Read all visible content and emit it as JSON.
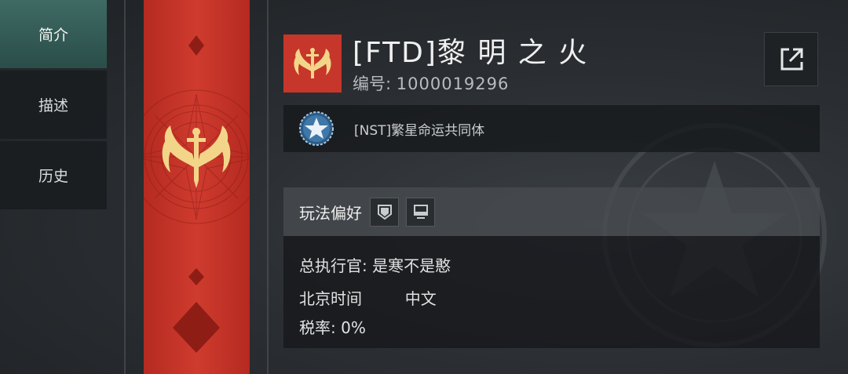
{
  "nav": {
    "items": [
      {
        "label": "简介",
        "active": true
      },
      {
        "label": "描述",
        "active": false
      },
      {
        "label": "历史",
        "active": false
      }
    ]
  },
  "banner": {
    "color": "#c7362a",
    "emblem_color": "#f3d58a",
    "emblem": "winged-sword-emblem"
  },
  "guild": {
    "name": "[FTD]黎 明 之 火",
    "id_label": "编号:",
    "id_value": "1000019296"
  },
  "share": {
    "icon": "external-link-icon"
  },
  "alliance": {
    "icon": "star-globe-icon",
    "name": "[NST]繁星命运共同体"
  },
  "preference": {
    "label": "玩法偏好",
    "badges": [
      "shield-badge-icon",
      "monitor-badge-icon"
    ]
  },
  "info": {
    "commander_label": "总执行官:",
    "commander_value": "是寒不是憨",
    "timezone": "北京时间",
    "language": "中文",
    "tax_label": "税率:",
    "tax_value": "0%"
  },
  "colors": {
    "accent": "#3e6a63",
    "banner_red": "#c7362a",
    "gold": "#f3d58a"
  }
}
